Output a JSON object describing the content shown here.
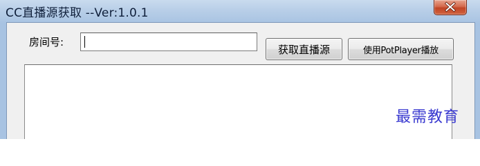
{
  "window": {
    "title": "CC直播源获取 --Ver:1.0.1"
  },
  "form": {
    "room_label": "房间号:",
    "room_value": "",
    "get_button_label": "获取直播源",
    "play_button_label": "使用PotPlayer播放"
  },
  "output": {
    "text": ""
  },
  "watermark": {
    "text": "最需教育"
  },
  "icons": {
    "close": "close-icon"
  },
  "colors": {
    "title_bar": "#b9cfe8",
    "close_button": "#c14526",
    "client_background": "#f0f0f0",
    "watermark": "#3a3ad0"
  }
}
